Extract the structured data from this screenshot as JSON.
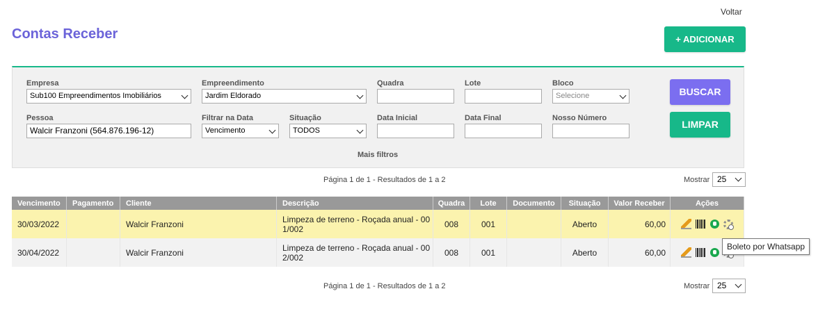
{
  "header": {
    "back_link": "Voltar",
    "title": "Contas Receber",
    "add_button": "+ ADICIONAR"
  },
  "filters": {
    "empresa": {
      "label": "Empresa",
      "value": "Sub100 Empreendimentos Imobiliários"
    },
    "empreendimento": {
      "label": "Empreendimento",
      "value": "Jardim Eldorado"
    },
    "quadra": {
      "label": "Quadra",
      "value": ""
    },
    "lote": {
      "label": "Lote",
      "value": ""
    },
    "bloco": {
      "label": "Bloco",
      "value": "Selecione"
    },
    "pessoa": {
      "label": "Pessoa",
      "value": "Walcir Franzoni (564.876.196-12)"
    },
    "filtrar_data": {
      "label": "Filtrar na Data",
      "value": "Vencimento"
    },
    "situacao": {
      "label": "Situação",
      "value": "TODOS"
    },
    "data_inicial": {
      "label": "Data Inicial",
      "value": ""
    },
    "data_final": {
      "label": "Data Final",
      "value": ""
    },
    "nosso_numero": {
      "label": "Nosso Número",
      "value": ""
    },
    "buscar_button": "BUSCAR",
    "limpar_button": "LIMPAR",
    "mais_filtros": "Mais filtros"
  },
  "pagination": {
    "text": "Página 1 de 1 - Resultados de 1 a 2",
    "mostrar_label": "Mostrar",
    "page_size": "25"
  },
  "table": {
    "headers": [
      "Vencimento",
      "Pagamento",
      "Cliente",
      "Descrição",
      "Quadra",
      "Lote",
      "Documento",
      "Situação",
      "Valor Receber",
      "Ações"
    ],
    "rows": [
      {
        "vencimento": "30/03/2022",
        "pagamento": "",
        "cliente": "Walcir Franzoni",
        "descricao": "Limpeza de terreno - Roçada anual - 00 1/002",
        "quadra": "008",
        "lote": "001",
        "documento": "",
        "situacao": "Aberto",
        "valor": "60,00"
      },
      {
        "vencimento": "30/04/2022",
        "pagamento": "",
        "cliente": "Walcir Franzoni",
        "descricao": "Limpeza de terreno - Roçada anual - 00 2/002",
        "quadra": "008",
        "lote": "001",
        "documento": "",
        "situacao": "Aberto",
        "valor": "60,00"
      }
    ]
  },
  "tooltip": "Boleto por Whatsapp",
  "colors": {
    "title": "#6b63d9",
    "primary_green": "#17b889",
    "buscar_purple": "#7b6ef0",
    "highlight_row": "#fbf3ae",
    "table_header": "#999999"
  },
  "icons": [
    "pencil-icon",
    "barcode-icon",
    "whatsapp-icon",
    "gear-icon"
  ]
}
